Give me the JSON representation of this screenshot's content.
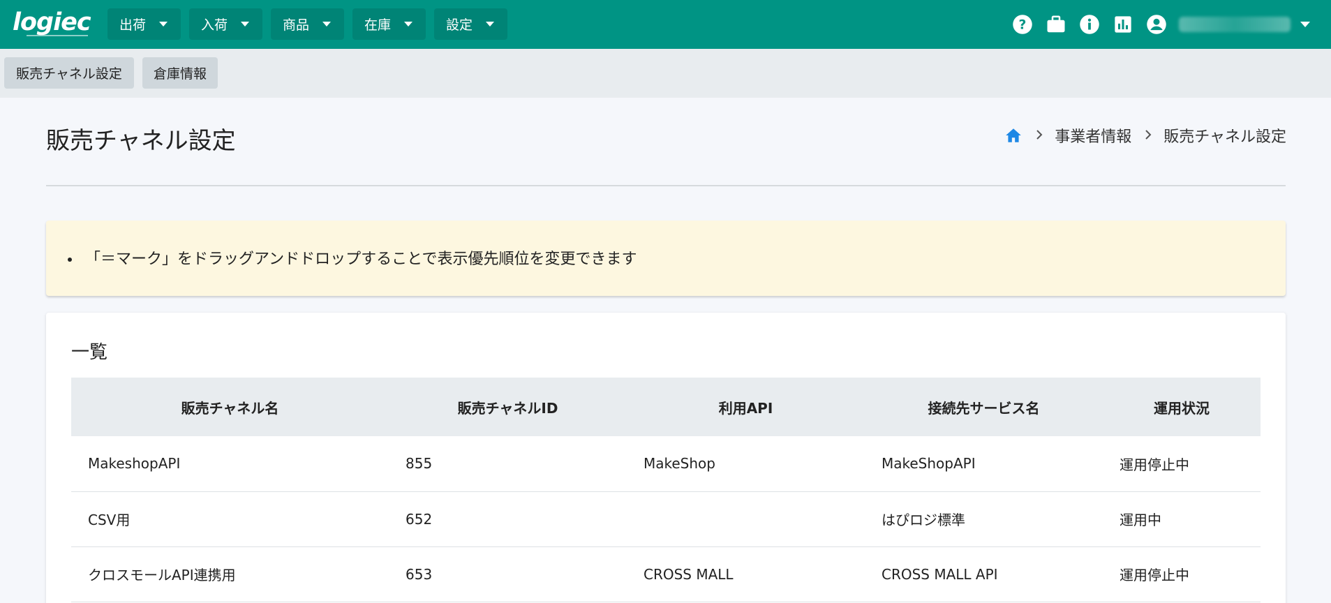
{
  "header": {
    "logo_text": "logiec",
    "menu": [
      {
        "label": "出荷"
      },
      {
        "label": "入荷"
      },
      {
        "label": "商品"
      },
      {
        "label": "在庫"
      },
      {
        "label": "設定"
      }
    ],
    "icons": [
      "help-icon",
      "briefcase-icon",
      "info-icon",
      "bar-chart-icon",
      "account-icon"
    ]
  },
  "subtabs": [
    {
      "label": "販売チャネル設定"
    },
    {
      "label": "倉庫情報"
    }
  ],
  "page": {
    "title": "販売チャネル設定",
    "breadcrumb": [
      "事業者情報",
      "販売チャネル設定"
    ]
  },
  "notice": {
    "text": "「＝マーク」をドラッグアンドドロップすることで表示優先順位を変更できます"
  },
  "list": {
    "title": "一覧",
    "columns": [
      "販売チャネル名",
      "販売チャネルID",
      "利用API",
      "接続先サービス名",
      "運用状況"
    ],
    "rows": [
      [
        "MakeshopAPI",
        "855",
        "MakeShop",
        "MakeShopAPI",
        "運用停止中"
      ],
      [
        "CSV用",
        "652",
        "",
        "はぴロジ標準",
        "運用中"
      ],
      [
        "クロスモールAPI連携用",
        "653",
        "CROSS MALL",
        "CROSS MALL API",
        "運用停止中"
      ]
    ]
  },
  "colors": {
    "brand": "#009484",
    "notice_bg": "#fdf7e0",
    "link": "#1e88e5"
  }
}
